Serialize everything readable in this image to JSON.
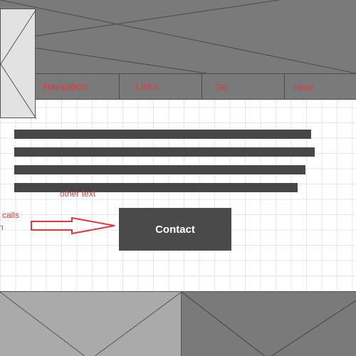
{
  "header": {
    "banner_icon": "image-placeholder",
    "logo_icon": "image-placeholder"
  },
  "nav": {
    "items": [
      {
        "label": "Navigation"
      },
      {
        "label": "Links"
      },
      {
        "label": "Go"
      },
      {
        "label": "Here"
      }
    ]
  },
  "content": {
    "body_text_lines": 4,
    "other_text_note": "other text",
    "calls_note_line1": "calls",
    "calls_note_line2": "n"
  },
  "cta": {
    "contact_label": "Contact"
  },
  "footer": {
    "left_icon": "image-placeholder",
    "right_icon": "image-placeholder"
  },
  "colors": {
    "annotation": "#e0383d",
    "placeholder_dark": "#7a7a7a",
    "placeholder_light": "#e2e2e2",
    "button": "#4a4a4a"
  }
}
